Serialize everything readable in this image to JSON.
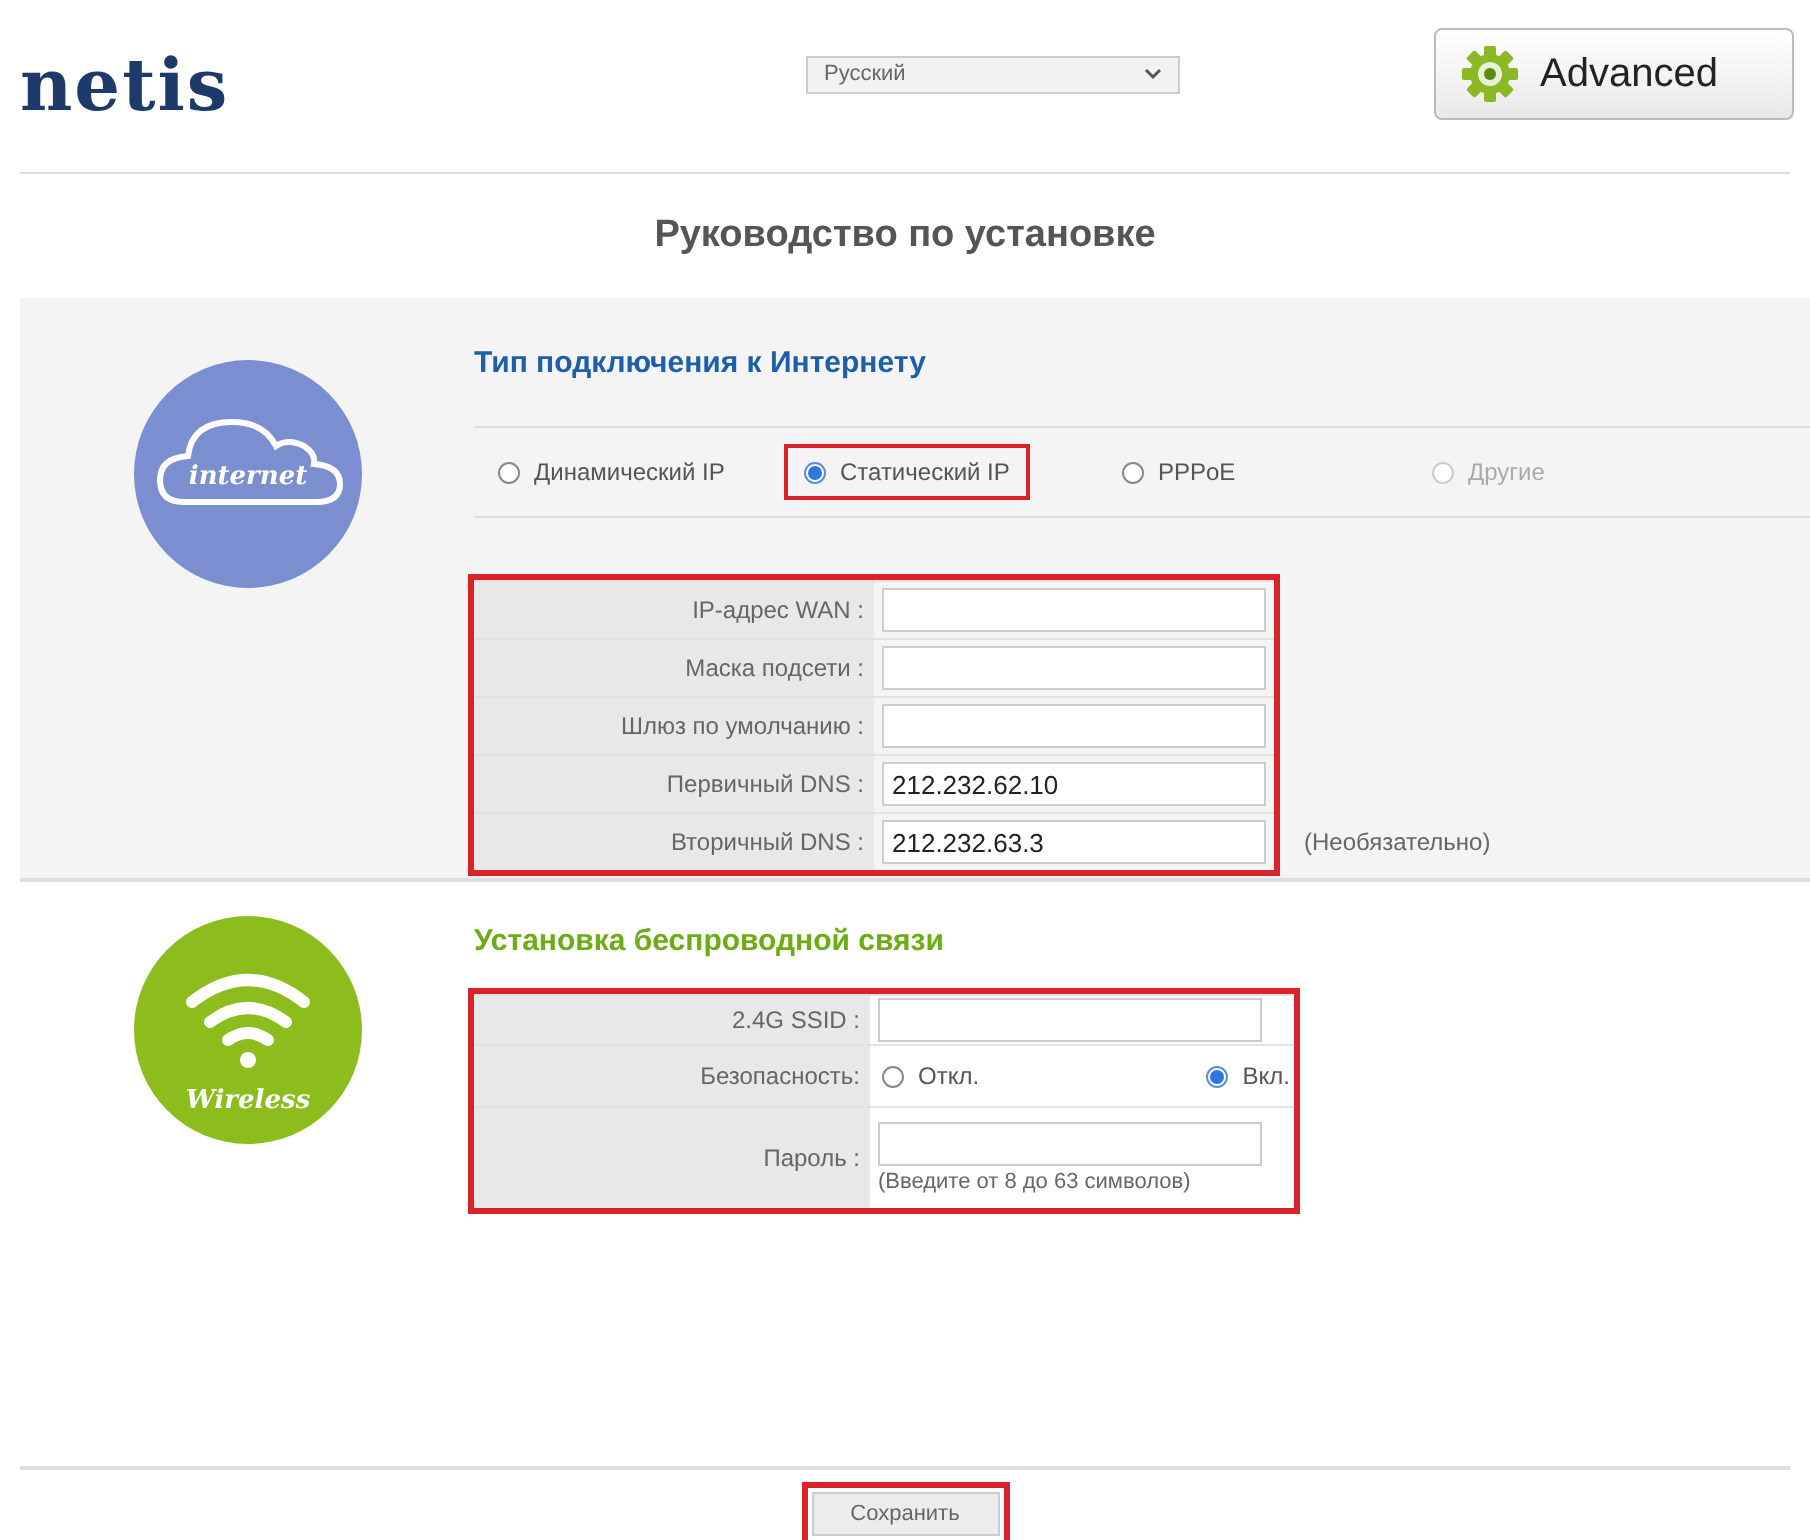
{
  "header": {
    "logo": "netis",
    "language": {
      "value": "Русский"
    },
    "advanced_button": {
      "label": "Advanced"
    }
  },
  "title": "Руководство по установке",
  "internet": {
    "icon_label": "internet",
    "heading": "Тип подключения к Интернету",
    "connection_types": [
      {
        "label": "Динамический IP",
        "selected": false,
        "disabled": false,
        "highlighted": false
      },
      {
        "label": "Статический IP",
        "selected": true,
        "disabled": false,
        "highlighted": true
      },
      {
        "label": "PPPoE",
        "selected": false,
        "disabled": false,
        "highlighted": false
      },
      {
        "label": "Другие",
        "selected": false,
        "disabled": true,
        "highlighted": false
      }
    ],
    "fields_highlighted": true,
    "fields": [
      {
        "label": "IP-адрес WAN :"
      },
      {
        "label": "Маска подсети :"
      },
      {
        "label": "Шлюз по умолчанию :"
      },
      {
        "label": "Первичный DNS :",
        "value": "212.232.62.10"
      },
      {
        "label": "Вторичный DNS :",
        "value": "212.232.63.3",
        "note": "(Необязательно)"
      }
    ]
  },
  "wireless": {
    "icon_label": "Wireless",
    "heading": "Установка беспроводной связи",
    "highlighted": true,
    "ssid": {
      "label": "2.4G SSID :"
    },
    "security": {
      "label": "Безопасность:",
      "options": [
        {
          "label": "Откл.",
          "selected": false
        },
        {
          "label": "Вкл.",
          "selected": true
        }
      ]
    },
    "password": {
      "label": "Пароль :",
      "hint": "(Введите от 8 до 63 символов)"
    }
  },
  "save_button": {
    "label": "Сохранить",
    "highlighted": true
  }
}
